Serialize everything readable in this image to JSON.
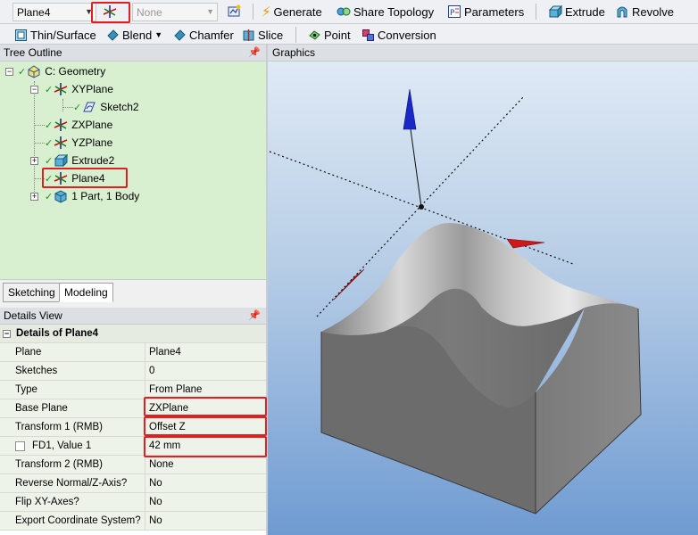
{
  "toolbar1": {
    "plane_combo": "Plane4",
    "sketch_combo": "None",
    "generate": "Generate",
    "share_topology": "Share Topology",
    "parameters": "Parameters",
    "extrude": "Extrude",
    "revolve": "Revolve"
  },
  "toolbar2": {
    "thin_surface": "Thin/Surface",
    "blend": "Blend",
    "chamfer": "Chamfer",
    "slice": "Slice",
    "point": "Point",
    "conversion": "Conversion"
  },
  "tree": {
    "title": "Tree Outline",
    "nodes": [
      {
        "label": "C: Geometry",
        "icon": "geometry-icon"
      },
      {
        "label": "XYPlane",
        "icon": "plane-axes-icon"
      },
      {
        "label": "Sketch2",
        "icon": "sketch-icon"
      },
      {
        "label": "ZXPlane",
        "icon": "plane-axes-icon"
      },
      {
        "label": "YZPlane",
        "icon": "plane-axes-icon"
      },
      {
        "label": "Extrude2",
        "icon": "extrude-icon"
      },
      {
        "label": "Plane4",
        "icon": "plane-axes-icon"
      },
      {
        "label": "1 Part, 1 Body",
        "icon": "body-icon"
      }
    ]
  },
  "tabs": [
    "Sketching",
    "Modeling"
  ],
  "details": {
    "title": "Details View",
    "group": "Details of Plane4",
    "rows": [
      {
        "label": "Plane",
        "value": "Plane4"
      },
      {
        "label": "Sketches",
        "value": "0"
      },
      {
        "label": "Type",
        "value": "From Plane"
      },
      {
        "label": "Base Plane",
        "value": "ZXPlane"
      },
      {
        "label": "Transform 1 (RMB)",
        "value": "Offset Z"
      },
      {
        "label": "FD1, Value 1",
        "value": "42 mm"
      },
      {
        "label": "Transform 2 (RMB)",
        "value": "None"
      },
      {
        "label": "Reverse Normal/Z-Axis?",
        "value": "No"
      },
      {
        "label": "Flip XY-Axes?",
        "value": "No"
      },
      {
        "label": "Export Coordinate System?",
        "value": "No"
      }
    ]
  },
  "graphics": {
    "title": "Graphics"
  },
  "colors": {
    "highlight": "#e02020",
    "tree_bg": "#d8f0d0",
    "graphics_bottom": "#6f9bd2"
  }
}
